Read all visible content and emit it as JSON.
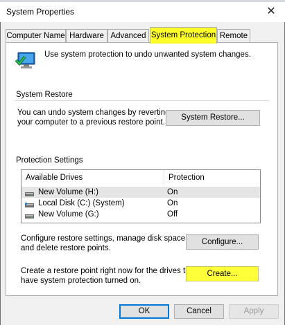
{
  "window": {
    "title": "System Properties",
    "close_glyph": "✕"
  },
  "tabs": [
    {
      "label": "Computer Name"
    },
    {
      "label": "Hardware"
    },
    {
      "label": "Advanced"
    },
    {
      "label": "System Protection",
      "active": true
    },
    {
      "label": "Remote"
    }
  ],
  "intro": {
    "text": "Use system protection to undo unwanted system changes."
  },
  "system_restore": {
    "title": "System Restore",
    "description_line1": "You can undo system changes by reverting",
    "description_line2": "your computer to a previous restore point.",
    "button": "System Restore..."
  },
  "protection": {
    "title": "Protection Settings",
    "columns": [
      "Available Drives",
      "Protection"
    ],
    "drives": [
      {
        "name": "New Volume (H:)",
        "protection": "On",
        "icon": "drive-icon",
        "selected": true
      },
      {
        "name": "Local Disk (C:) (System)",
        "protection": "On",
        "icon": "system-drive-icon"
      },
      {
        "name": "New Volume (G:)",
        "protection": "Off",
        "icon": "drive-icon"
      }
    ],
    "configure_line1": "Configure restore settings, manage disk space,",
    "configure_line2": "and delete restore points.",
    "configure_button": "Configure...",
    "create_line1": "Create a restore point right now for the drives that",
    "create_line2": "have system protection turned on.",
    "create_button": "Create..."
  },
  "footer": {
    "ok": "OK",
    "cancel": "Cancel",
    "apply": "Apply"
  },
  "colors": {
    "highlight": "#ffff2a",
    "accent": "#0078d7"
  }
}
